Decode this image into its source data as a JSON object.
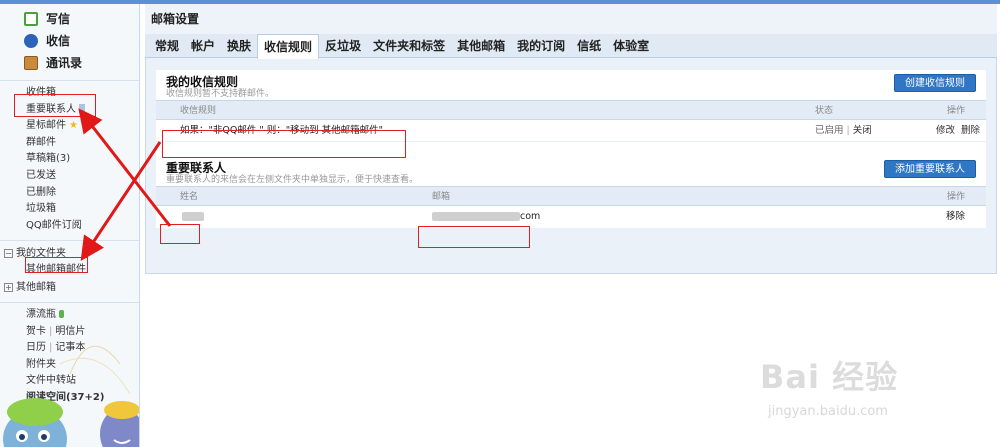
{
  "sidebar": {
    "main": [
      {
        "label": "写信",
        "icon": "write-icon"
      },
      {
        "label": "收信",
        "icon": "receive-icon"
      },
      {
        "label": "通讯录",
        "icon": "contacts-icon"
      }
    ],
    "folders": [
      "收件箱",
      "重要联系人",
      "星标邮件",
      "群邮件",
      "草稿箱(3)",
      "已发送",
      "已删除",
      "垃圾箱",
      "QQ邮件订阅"
    ],
    "my_folders_label": "我的文件夹",
    "my_folder_child": "其他邮箱邮件",
    "other_mailbox_label": "其他邮箱",
    "tools": {
      "drift_bottle": "漂流瓶",
      "greeting_card": "贺卡",
      "postcard": "明信片",
      "calendar": "日历",
      "notebook": "记事本",
      "attachments": "附件夹",
      "file_transfer": "文件中转站",
      "reading_space": "阅读空间(37+2)"
    }
  },
  "main": {
    "title": "邮箱设置",
    "tabs": [
      "常规",
      "帐户",
      "换肤",
      "收信规则",
      "反垃圾",
      "文件夹和标签",
      "其他邮箱",
      "我的订阅",
      "信纸",
      "体验室"
    ],
    "active_tab": "收信规则",
    "rules": {
      "title": "我的收信规则",
      "subtitle": "收信规则暂不支持群邮件。",
      "create_button": "创建收信规则",
      "col_rule": "收信规则",
      "col_status": "状态",
      "col_action": "操作",
      "rule_text": "如果：\"非QQ邮件 \"    则：\"移动到 其他邮箱邮件\"",
      "status_on": "已启用",
      "status_off": "关闭",
      "action_edit": "修改",
      "action_delete": "删除"
    },
    "important": {
      "title": "重要联系人",
      "subtitle": "重要联系人的来信会在左侧文件夹中单独显示，便于快速查看。",
      "add_button": "添加重要联系人",
      "col_name": "姓名",
      "col_email": "邮箱",
      "col_action": "操作",
      "email_suffix": "com",
      "action_remove": "移除"
    }
  },
  "watermark": {
    "main": "Bai 经验",
    "sub": "jingyan.baidu.com"
  },
  "colors": {
    "accent": "#2f76c5",
    "highlight": "#e02020"
  }
}
